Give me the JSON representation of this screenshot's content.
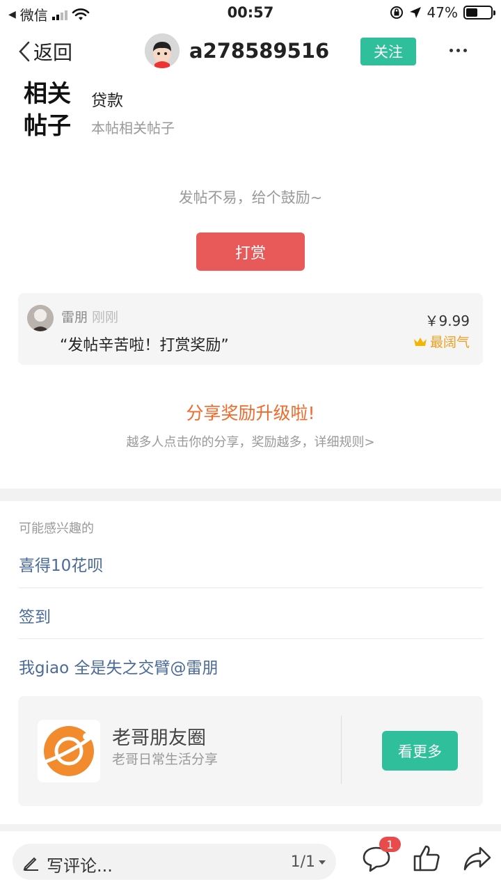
{
  "status_bar": {
    "carrier": "微信",
    "time": "00:57",
    "battery": "47%",
    "battery_level": 0.47
  },
  "nav": {
    "back_label": "返回",
    "username": "a278589516",
    "follow_label": "关注"
  },
  "related": {
    "title": "相关帖子",
    "main": "贷款",
    "sub": "本帖相关帖子"
  },
  "reward": {
    "encourage": "发帖不易，给个鼓励~",
    "button": "打赏"
  },
  "tip": {
    "name": "雷朋",
    "time": "刚刚",
    "message": "“发帖辛苦啦！打赏奖励”",
    "amount": "￥9.99",
    "badge": "最阔气"
  },
  "share": {
    "title": "分享奖励升级啦!",
    "sub": "越多人点击你的分享，奖励越多，详细规则>"
  },
  "interest": {
    "label": "可能感兴趣的",
    "items": [
      "喜得10花呗",
      "签到",
      "我giao 全是失之交臂@雷朋"
    ]
  },
  "circle": {
    "name": "老哥朋友圈",
    "desc": "老哥日常生活分享",
    "button": "看更多"
  },
  "bottom": {
    "placeholder": "写评论...",
    "page": "1/1",
    "comment_count": "1"
  },
  "colors": {
    "green": "#2fbf9b",
    "red": "#e85a5a",
    "orange": "#f06a2b",
    "link": "#4a6a9c"
  }
}
